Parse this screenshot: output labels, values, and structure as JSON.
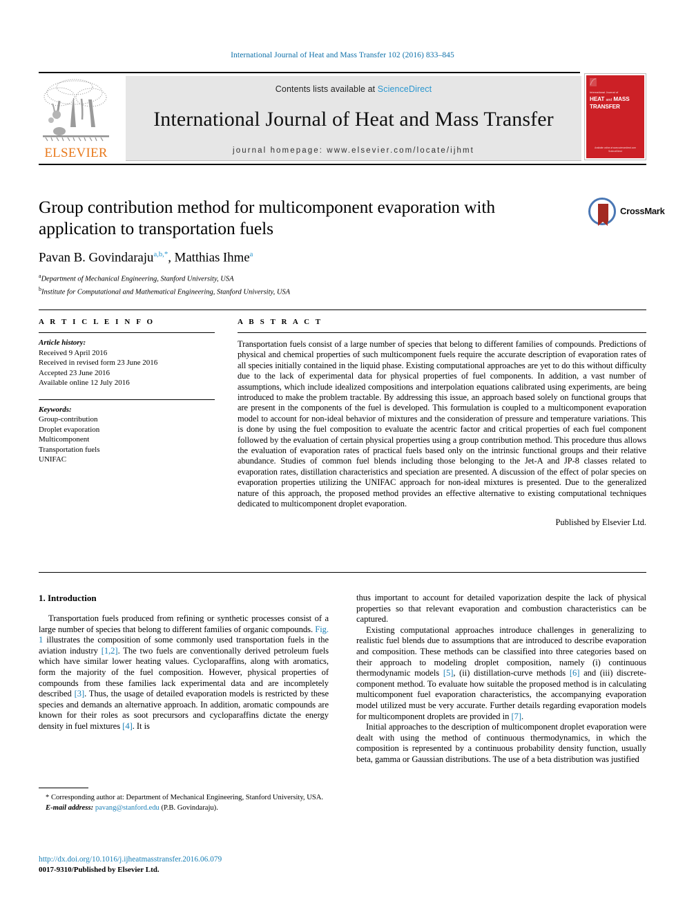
{
  "running_head": "International Journal of Heat and Mass Transfer 102 (2016) 833–845",
  "masthead": {
    "contents_prefix": "Contents lists available at ",
    "sciencedirect": "ScienceDirect",
    "journal_name": "International Journal of Heat and Mass Transfer",
    "homepage": "journal homepage: www.elsevier.com/locate/ijhmt",
    "publisher_logo_text": "ELSEVIER",
    "cover": {
      "kicker": "International Journal of",
      "title_line1_a": "HEAT",
      "title_line1_b": "and",
      "title_line1_c": "MASS",
      "title_line2": "TRANSFER",
      "footer_line1": "Available online at www.sciencedirect.com",
      "footer_line2": "ScienceDirect"
    }
  },
  "crossmark": {
    "label": "CrossMark"
  },
  "title": "Group contribution method for multicomponent evaporation with application to transportation fuels",
  "authors": {
    "author1_name": "Pavan B. Govindaraju",
    "author1_marks": "a,b,*",
    "separator": ", ",
    "author2_name": "Matthias Ihme",
    "author2_marks": "a"
  },
  "affiliations": [
    {
      "mark": "a",
      "text": "Department of Mechanical Engineering, Stanford University, USA"
    },
    {
      "mark": "b",
      "text": "Institute for Computational and Mathematical Engineering, Stanford University, USA"
    }
  ],
  "article_info": {
    "heading": "A R T I C L E   I N F O",
    "history_label": "Article history:",
    "history": [
      "Received 9 April 2016",
      "Received in revised form 23 June 2016",
      "Accepted 23 June 2016",
      "Available online 12 July 2016"
    ],
    "keywords_label": "Keywords:",
    "keywords": [
      "Group-contribution",
      "Droplet evaporation",
      "Multicomponent",
      "Transportation fuels",
      "UNIFAC"
    ]
  },
  "abstract": {
    "heading": "A B S T R A C T",
    "text": "Transportation fuels consist of a large number of species that belong to different families of compounds. Predictions of physical and chemical properties of such multicomponent fuels require the accurate description of evaporation rates of all species initially contained in the liquid phase. Existing computational approaches are yet to do this without difficulty due to the lack of experimental data for physical properties of fuel components. In addition, a vast number of assumptions, which include idealized compositions and interpolation equations calibrated using experiments, are being introduced to make the problem tractable. By addressing this issue, an approach based solely on functional groups that are present in the components of the fuel is developed. This formulation is coupled to a multicomponent evaporation model to account for non-ideal behavior of mixtures and the consideration of pressure and temperature variations. This is done by using the fuel composition to evaluate the acentric factor and critical properties of each fuel component followed by the evaluation of certain physical properties using a group contribution method. This procedure thus allows the evaluation of evaporation rates of practical fuels based only on the intrinsic functional groups and their relative abundance. Studies of common fuel blends including those belonging to the Jet-A and JP-8 classes related to evaporation rates, distillation characteristics and speciation are presented. A discussion of the effect of polar species on evaporation properties utilizing the UNIFAC approach for non-ideal mixtures is presented. Due to the generalized nature of this approach, the proposed method provides an effective alternative to existing computational techniques dedicated to multicomponent droplet evaporation.",
    "signature": "Published by Elsevier Ltd."
  },
  "introduction": {
    "heading": "1. Introduction",
    "left_paragraph_1_a": "Transportation fuels produced from refining or synthetic processes consist of a large number of species that belong to different families of organic compounds. ",
    "left_ref_fig1": "Fig. 1",
    "left_paragraph_1_b": " illustrates the composition of some commonly used transportation fuels in the aviation industry ",
    "left_ref_12": "[1,2]",
    "left_paragraph_1_c": ". The two fuels are conventionally derived petroleum fuels which have similar lower heating values. Cycloparaffins, along with aromatics, form the majority of the fuel composition. However, physical properties of compounds from these families lack experimental data and are incompletely described ",
    "left_ref_3": "[3]",
    "left_paragraph_1_d": ". Thus, the usage of detailed evaporation models is restricted by these species and demands an alternative approach. In addition, aromatic compounds are known for their roles as soot precursors and cycloparaffins dictate the energy density in fuel mixtures ",
    "left_ref_4": "[4]",
    "left_paragraph_1_e": ". It is",
    "right_paragraph_1": "thus important to account for detailed vaporization despite the lack of physical properties so that relevant evaporation and combustion characteristics can be captured.",
    "right_paragraph_2_a": "Existing computational approaches introduce challenges in generalizing to realistic fuel blends due to assumptions that are introduced to describe evaporation and composition. These methods can be classified into three categories based on their approach to modeling droplet composition, namely (i) continuous thermodynamic models ",
    "right_ref_5": "[5]",
    "right_paragraph_2_b": ", (ii) distillation-curve methods ",
    "right_ref_6": "[6]",
    "right_paragraph_2_c": " and (iii) discrete-component method. To evaluate how suitable the proposed method is in calculating multicomponent fuel evaporation characteristics, the accompanying evaporation model utilized must be very accurate. Further details regarding evaporation models for multicomponent droplets are provided in ",
    "right_ref_7": "[7]",
    "right_paragraph_2_d": ".",
    "right_paragraph_3": "Initial approaches to the description of multicomponent droplet evaporation were dealt with using the method of continuous thermodynamics, in which the composition is represented by a continuous probability density function, usually beta, gamma or Gaussian distributions. The use of a beta distribution was justified"
  },
  "footnotes": {
    "corresponding_marker": "*",
    "corresponding_text": " Corresponding author at: Department of Mechanical Engineering, Stanford University, USA.",
    "email_label": "E-mail address:",
    "email": "pavang@stanford.edu",
    "email_owner": " (P.B. Govindaraju)."
  },
  "doi": {
    "url": "http://dx.doi.org/10.1016/j.ijheatmasstransfer.2016.06.079",
    "issn_line": "0017-9310/Published by Elsevier Ltd."
  },
  "colors": {
    "link": "#1a7fb5",
    "sciencedirect": "#2a97d0",
    "running_head": "#0b6ea8",
    "elsevier_orange": "#e87a1e",
    "cover_red": "#cc2026",
    "band_gray": "#e6e6e6"
  }
}
